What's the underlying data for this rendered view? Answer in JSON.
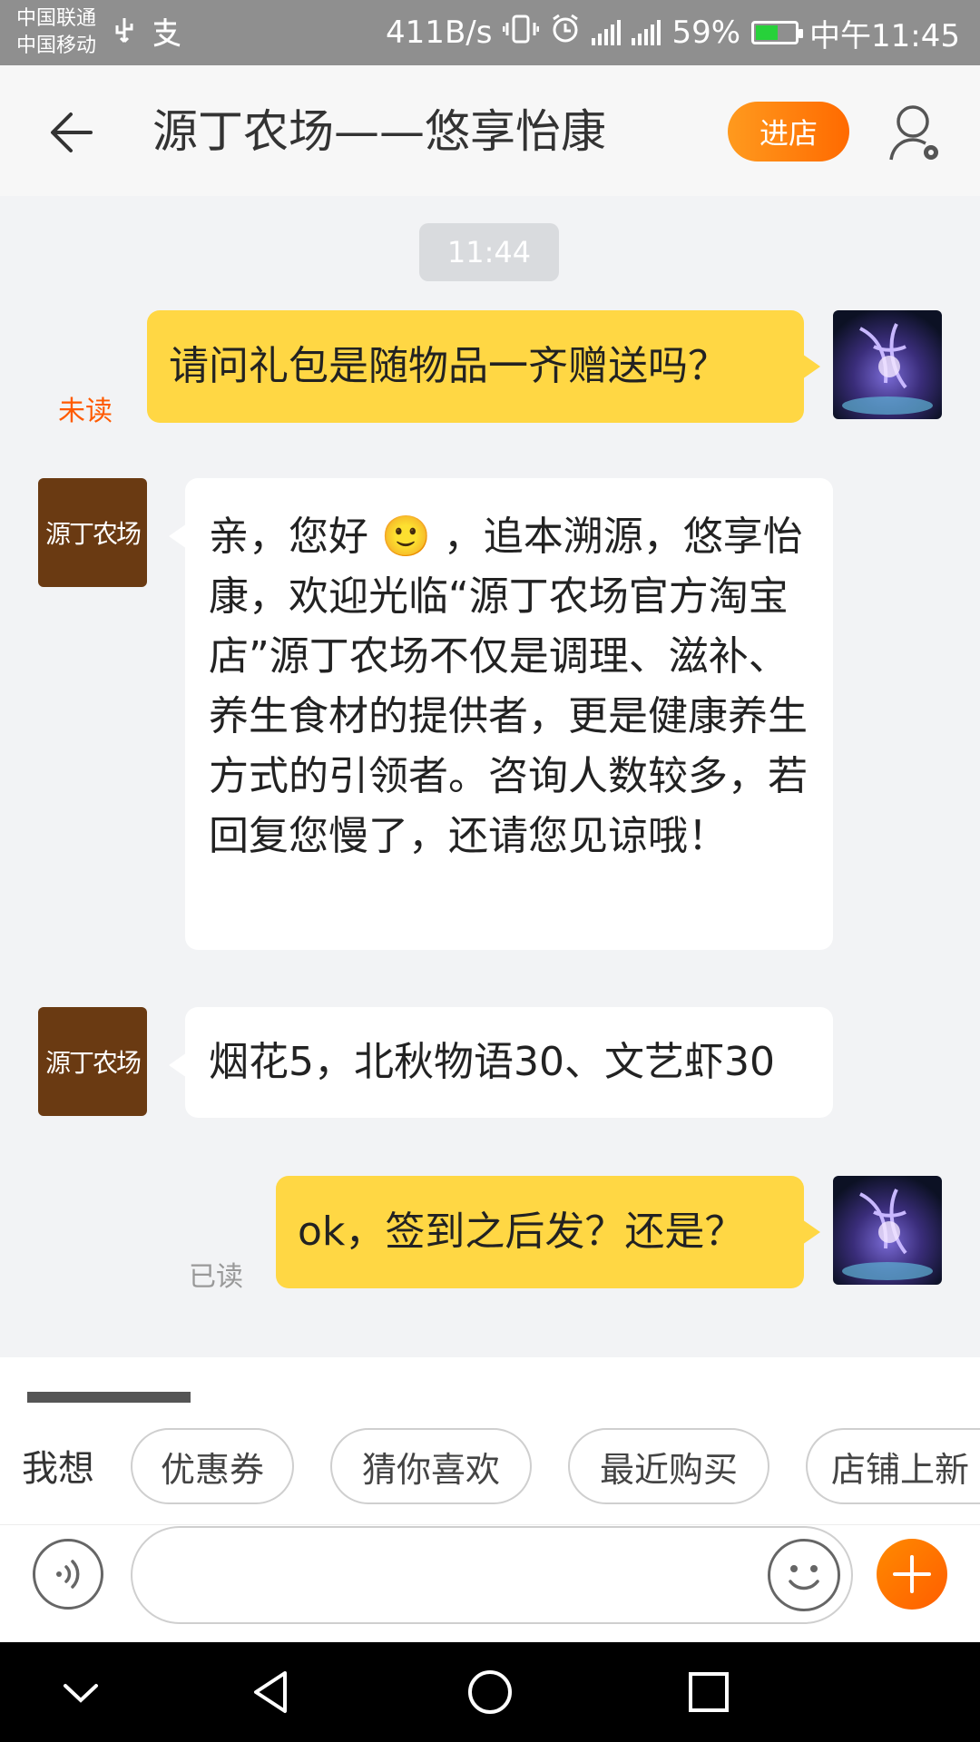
{
  "status_bar": {
    "carrier_1": "中国联通",
    "carrier_2": "中国移动",
    "speed": "411B/s",
    "network": "4G",
    "battery": "59%",
    "battery_level": 0.59,
    "time": "中午11:45"
  },
  "header": {
    "title": "源丁农场——悠享怡康",
    "enter_store": "进店"
  },
  "chat": {
    "timestamp": "11:44",
    "messages": [
      {
        "from": "user",
        "text": "请问礼包是随物品一齐赠送吗？",
        "status": "未读"
      },
      {
        "from": "shop",
        "text": "亲，您好 🙂 ，追本溯源，悠享怡康，欢迎光临“源丁农场官方淘宝店”源丁农场不仅是调理、滋补、养生食材的提供者，更是健康养生方式的引领者。咨询人数较多，若回复您慢了，还请您见谅哦！"
      },
      {
        "from": "shop",
        "text": "烟花5，北秋物语30、文艺虾30"
      },
      {
        "from": "user",
        "text": "ok，签到之后发？还是？",
        "status": "已读"
      }
    ],
    "shop_avatar_text": "源丁农场"
  },
  "quick_replies": {
    "label": "我想",
    "chips": [
      "优惠券",
      "猜你喜欢",
      "最近购买",
      "店铺上新"
    ]
  },
  "input": {
    "placeholder": ""
  },
  "icons": {
    "back": "arrow-left-icon",
    "profile": "user-settings-icon",
    "voice": "voice-icon",
    "emoji": "emoji-icon",
    "plus": "plus-icon",
    "nav_down": "chevron-down-icon",
    "nav_back": "triangle-back-icon",
    "nav_home": "circle-home-icon",
    "nav_recent": "square-recent-icon"
  },
  "colors": {
    "accent": "#ff7a00",
    "user_bubble": "#ffd744",
    "unread": "#ff5a00"
  }
}
